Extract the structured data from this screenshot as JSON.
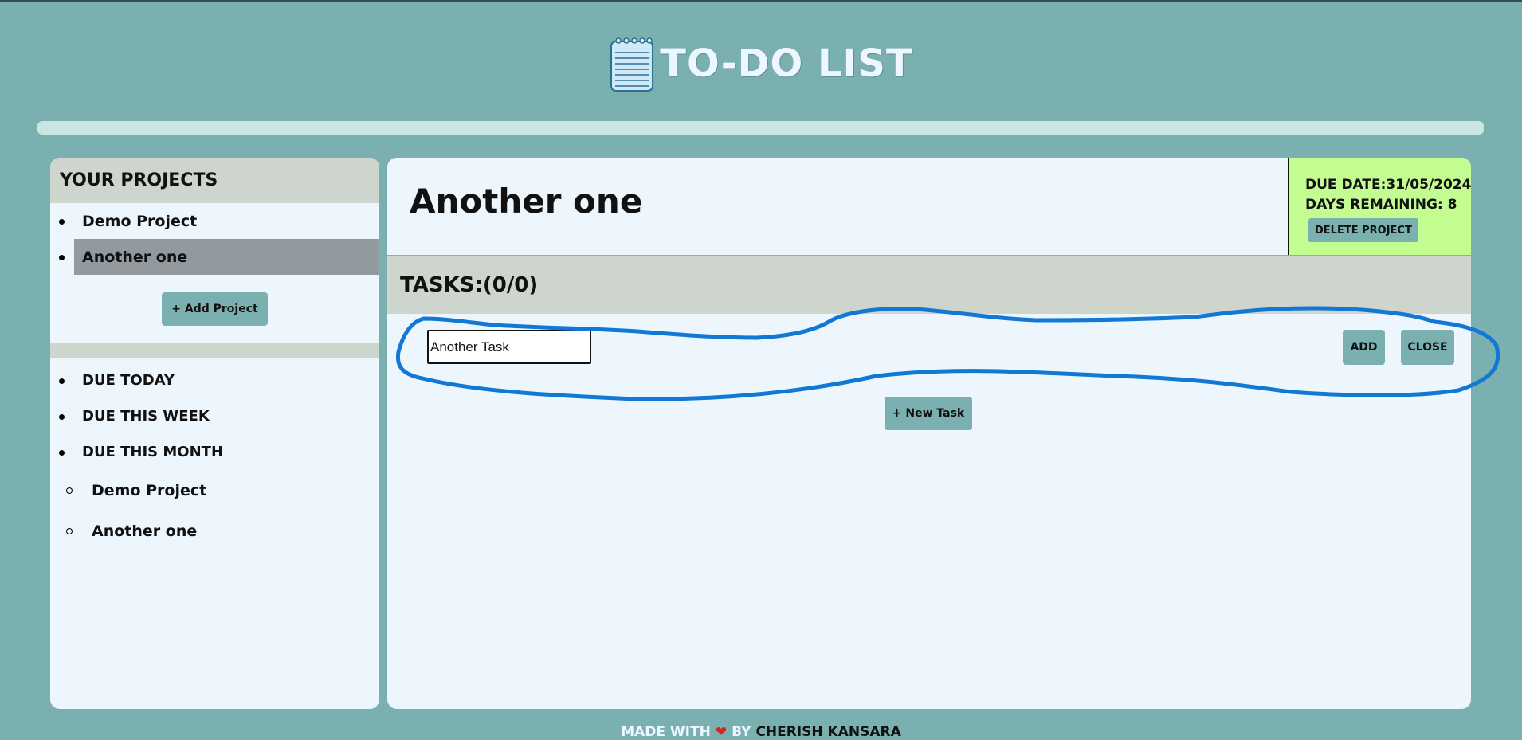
{
  "header": {
    "title": "TO-DO LIST",
    "logo_icon": "notepad-icon"
  },
  "sidebar": {
    "heading": "YOUR PROJECTS",
    "projects": [
      {
        "label": "Demo Project",
        "active": false
      },
      {
        "label": "Another one",
        "active": true
      }
    ],
    "add_project_label": "+ Add Project",
    "due_filters": [
      {
        "label": "DUE TODAY"
      },
      {
        "label": "DUE THIS WEEK"
      },
      {
        "label": "DUE THIS MONTH"
      }
    ],
    "due_month_projects": [
      {
        "label": "Demo Project"
      },
      {
        "label": "Another one"
      }
    ]
  },
  "main": {
    "project_title": "Another one",
    "due_date": "DUE DATE:31/05/2024",
    "days_remaining": "DAYS REMAINING: 8",
    "delete_label": "DELETE PROJECT",
    "tasks_heading": "TASKS:(0/0)",
    "task_input_value": "Another Task",
    "add_label": "ADD",
    "close_label": "CLOSE",
    "new_task_label": "+ New Task"
  },
  "footer": {
    "made_with": "MADE WITH",
    "by": "BY",
    "author": "CHERISH KANSARA",
    "heart_icon": "heart-icon"
  },
  "colors": {
    "background": "#7ab1b0",
    "panel": "#eef6fd",
    "heading_bar": "#cdd5cd",
    "active_project": "#939a9f",
    "due_box": "#c3fc90",
    "button": "#7ab1b0",
    "annotation": "#1178d6"
  }
}
